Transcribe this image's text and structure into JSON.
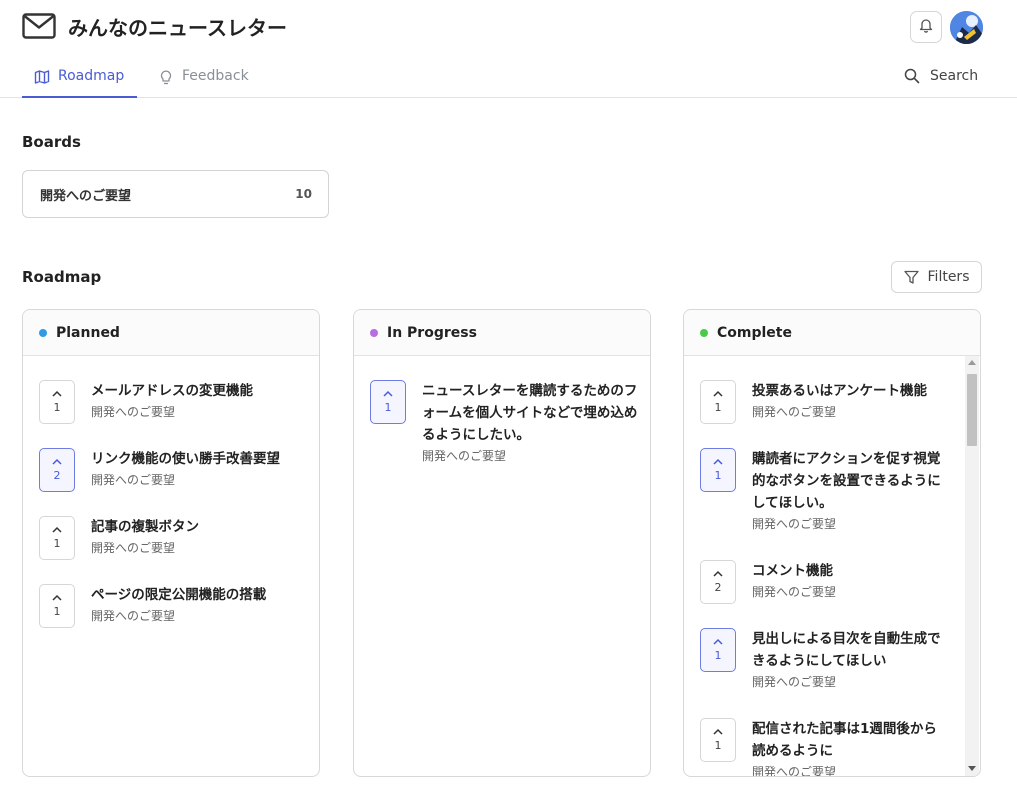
{
  "app": {
    "title": "みんなのニュースレター"
  },
  "nav": {
    "tabs": [
      {
        "label": "Roadmap",
        "icon": "map-icon",
        "active": true
      },
      {
        "label": "Feedback",
        "icon": "lightbulb-icon",
        "active": false
      }
    ],
    "search_label": "Search"
  },
  "boards": {
    "title": "Boards",
    "items": [
      {
        "name": "開発へのご要望",
        "count": "10"
      }
    ]
  },
  "roadmap": {
    "title": "Roadmap",
    "filters_label": "Filters",
    "columns": [
      {
        "title": "Planned",
        "color": "#2f9be5",
        "posts": [
          {
            "title": "メールアドレスの変更機能",
            "board": "開発へのご要望",
            "votes": "1",
            "voted": false
          },
          {
            "title": "リンク機能の使い勝手改善要望",
            "board": "開発へのご要望",
            "votes": "2",
            "voted": true
          },
          {
            "title": "記事の複製ボタン",
            "board": "開発へのご要望",
            "votes": "1",
            "voted": false
          },
          {
            "title": "ページの限定公開機能の搭載",
            "board": "開発へのご要望",
            "votes": "1",
            "voted": false
          }
        ]
      },
      {
        "title": "In Progress",
        "color": "#b56de0",
        "posts": [
          {
            "title": "ニュースレターを購読するためのフォームを個人サイトなどで埋め込めるようにしたい。",
            "board": "開発へのご要望",
            "votes": "1",
            "voted": true
          }
        ]
      },
      {
        "title": "Complete",
        "color": "#4bc94b",
        "posts": [
          {
            "title": "投票あるいはアンケート機能",
            "board": "開発へのご要望",
            "votes": "1",
            "voted": false
          },
          {
            "title": "購読者にアクションを促す視覚的なボタンを設置できるようにしてほしい。",
            "board": "開発へのご要望",
            "votes": "1",
            "voted": true
          },
          {
            "title": "コメント機能",
            "board": "開発へのご要望",
            "votes": "2",
            "voted": false
          },
          {
            "title": "見出しによる目次を自動生成できるようにしてほしい",
            "board": "開発へのご要望",
            "votes": "1",
            "voted": true
          },
          {
            "title": "配信された記事は1週間後から読めるように",
            "board": "開発へのご要望",
            "votes": "1",
            "voted": false
          }
        ]
      }
    ]
  }
}
